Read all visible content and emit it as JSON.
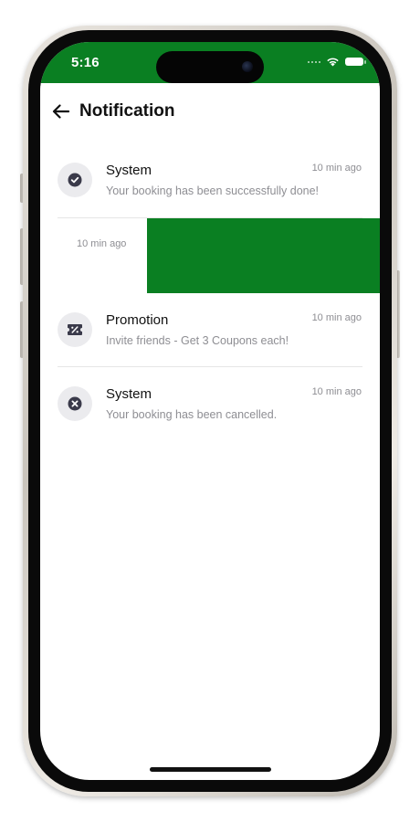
{
  "status_bar": {
    "time": "5:16"
  },
  "header": {
    "title": "Notification",
    "back_icon": "arrow-left-icon"
  },
  "notifications": [
    {
      "title": "System",
      "time": "10 min ago",
      "body": "Your booking has been successfully done!",
      "icon": "check-circle-icon"
    },
    {
      "title": "Promotion",
      "time": "10 min ago",
      "body": "Invite friends - Get 3 Coupons each!",
      "icon": "coupon-percent-icon"
    },
    {
      "title": "System",
      "time": "10 min ago",
      "body": "Your booking has been cancelled.",
      "icon": "x-circle-icon"
    }
  ],
  "swiped_item": {
    "time": "10 min ago"
  },
  "colors": {
    "brand_green": "#0a7f22",
    "icon_dark": "#3a3a4a",
    "muted_text": "#8e8e93"
  }
}
